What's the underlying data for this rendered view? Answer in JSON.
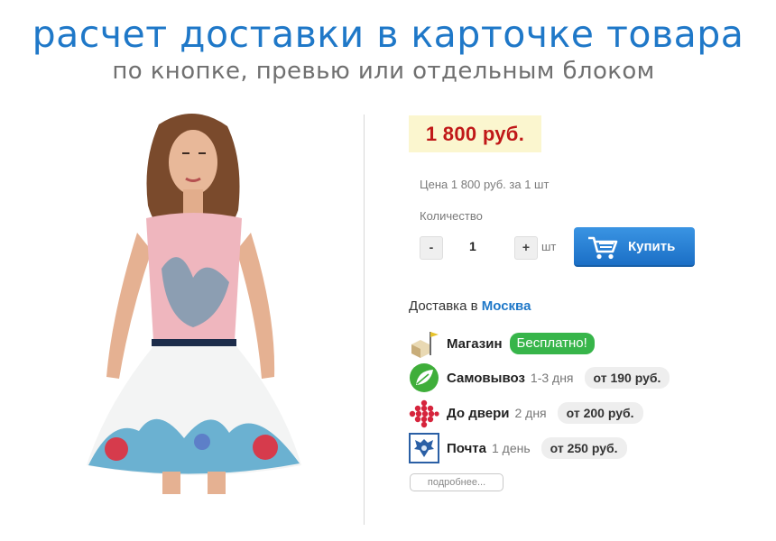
{
  "banner": {
    "title": "расчет доставки в карточке товара",
    "subtitle": "по кнопке, превью или отдельным блоком"
  },
  "product": {
    "price": "1 800 руб.",
    "price_per_unit": "Цена 1 800 руб. за 1 шт",
    "quantity_label": "Количество",
    "quantity": "1",
    "unit": "шт",
    "minus_label": "-",
    "plus_label": "+",
    "buy_label": "Купить"
  },
  "delivery": {
    "title_prefix": "Доставка в ",
    "city": "Москва",
    "options": [
      {
        "name": "Магазин",
        "days": "",
        "price": "Бесплатно!",
        "icon": "store-flag-icon"
      },
      {
        "name": "Самовывоз",
        "days": "1-3 дня",
        "price": "от 190 руб.",
        "icon": "pickup-leaf-icon"
      },
      {
        "name": "До двери",
        "days": "2 дня",
        "price": "от 200 руб.",
        "icon": "courier-dots-icon"
      },
      {
        "name": "Почта",
        "days": "1 день",
        "price": "от 250 руб.",
        "icon": "russian-post-eagle-icon"
      }
    ],
    "more_label": "подробнее..."
  },
  "colors": {
    "accent_blue": "#1f78c8",
    "price_red": "#c01818",
    "free_green": "#37b54a",
    "price_bg": "#fbf6cf"
  }
}
